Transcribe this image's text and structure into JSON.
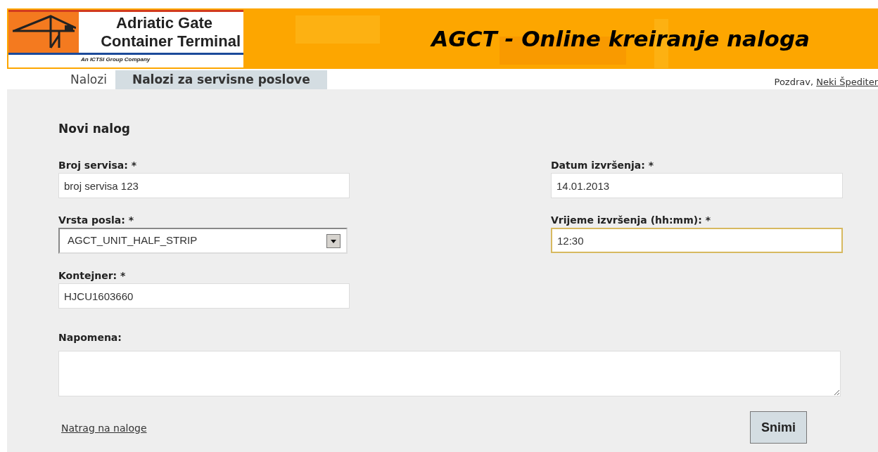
{
  "header": {
    "logo_line_1": "Adriatic Gate",
    "logo_line_2": "Container Terminal",
    "logo_tagline": "An ICTSI Group Company",
    "title": "AGCT - Online kreiranje naloga"
  },
  "tabs": [
    {
      "label": "Nalozi",
      "selected": false
    },
    {
      "label": "Nalozi za servisne poslove",
      "selected": true
    }
  ],
  "greeting": {
    "text": "Pozdrav,",
    "user": "Neki Špediter"
  },
  "form": {
    "title": "Novi nalog",
    "left_fields": [
      {
        "kind": "text",
        "label": "Broj servisa: *",
        "value": "broj servisa 123",
        "focused": false
      },
      {
        "kind": "select",
        "label": "Vrsta posla: *",
        "value": "AGCT_UNIT_HALF_STRIP",
        "focused": false
      },
      {
        "kind": "text",
        "label": "Kontejner: *",
        "value": "HJCU1603660",
        "focused": false
      }
    ],
    "right_fields": [
      {
        "kind": "text",
        "label": "Datum izvršenja: *",
        "value": "14.01.2013",
        "focused": false
      },
      {
        "kind": "text",
        "label": "Vrijeme izvršenja (hh:mm): *",
        "value": "12:30",
        "focused": true
      }
    ],
    "note_label": "Napomena:",
    "back_link": "Natrag na naloge",
    "save_button": "Snimi"
  }
}
